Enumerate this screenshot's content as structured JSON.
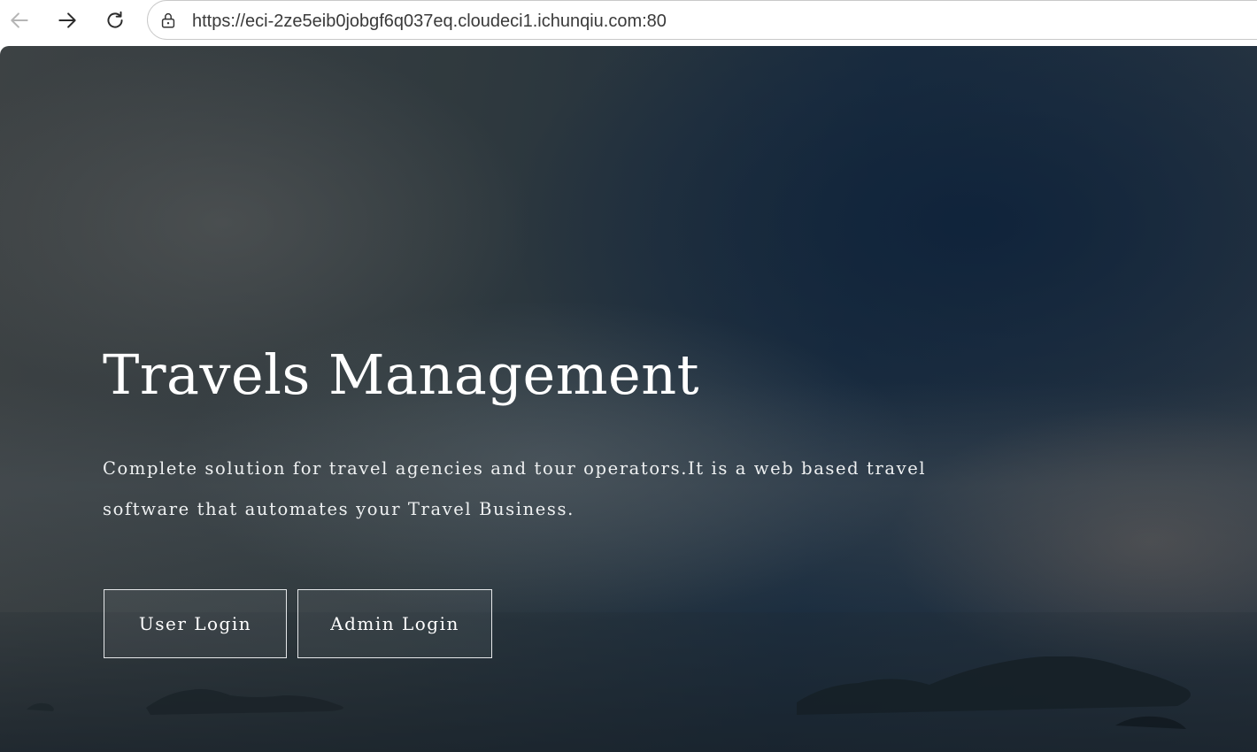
{
  "browser": {
    "url": "https://eci-2ze5eib0jobgf6q037eq.cloudeci1.ichunqiu.com:80",
    "icons": {
      "back": "arrow-left-icon",
      "forward": "arrow-right-icon",
      "reload": "reload-icon",
      "security": "lock-icon"
    }
  },
  "hero": {
    "title": "Travels Management",
    "description": "Complete solution for travel agencies and tour operators.It is a web based travel software that automates your Travel Business.",
    "buttons": {
      "user_login": "User Login",
      "admin_login": "Admin Login"
    }
  },
  "colors": {
    "text": "#ffffff",
    "button_border": "#e6e8ea",
    "url_text": "#3a3a3a"
  }
}
